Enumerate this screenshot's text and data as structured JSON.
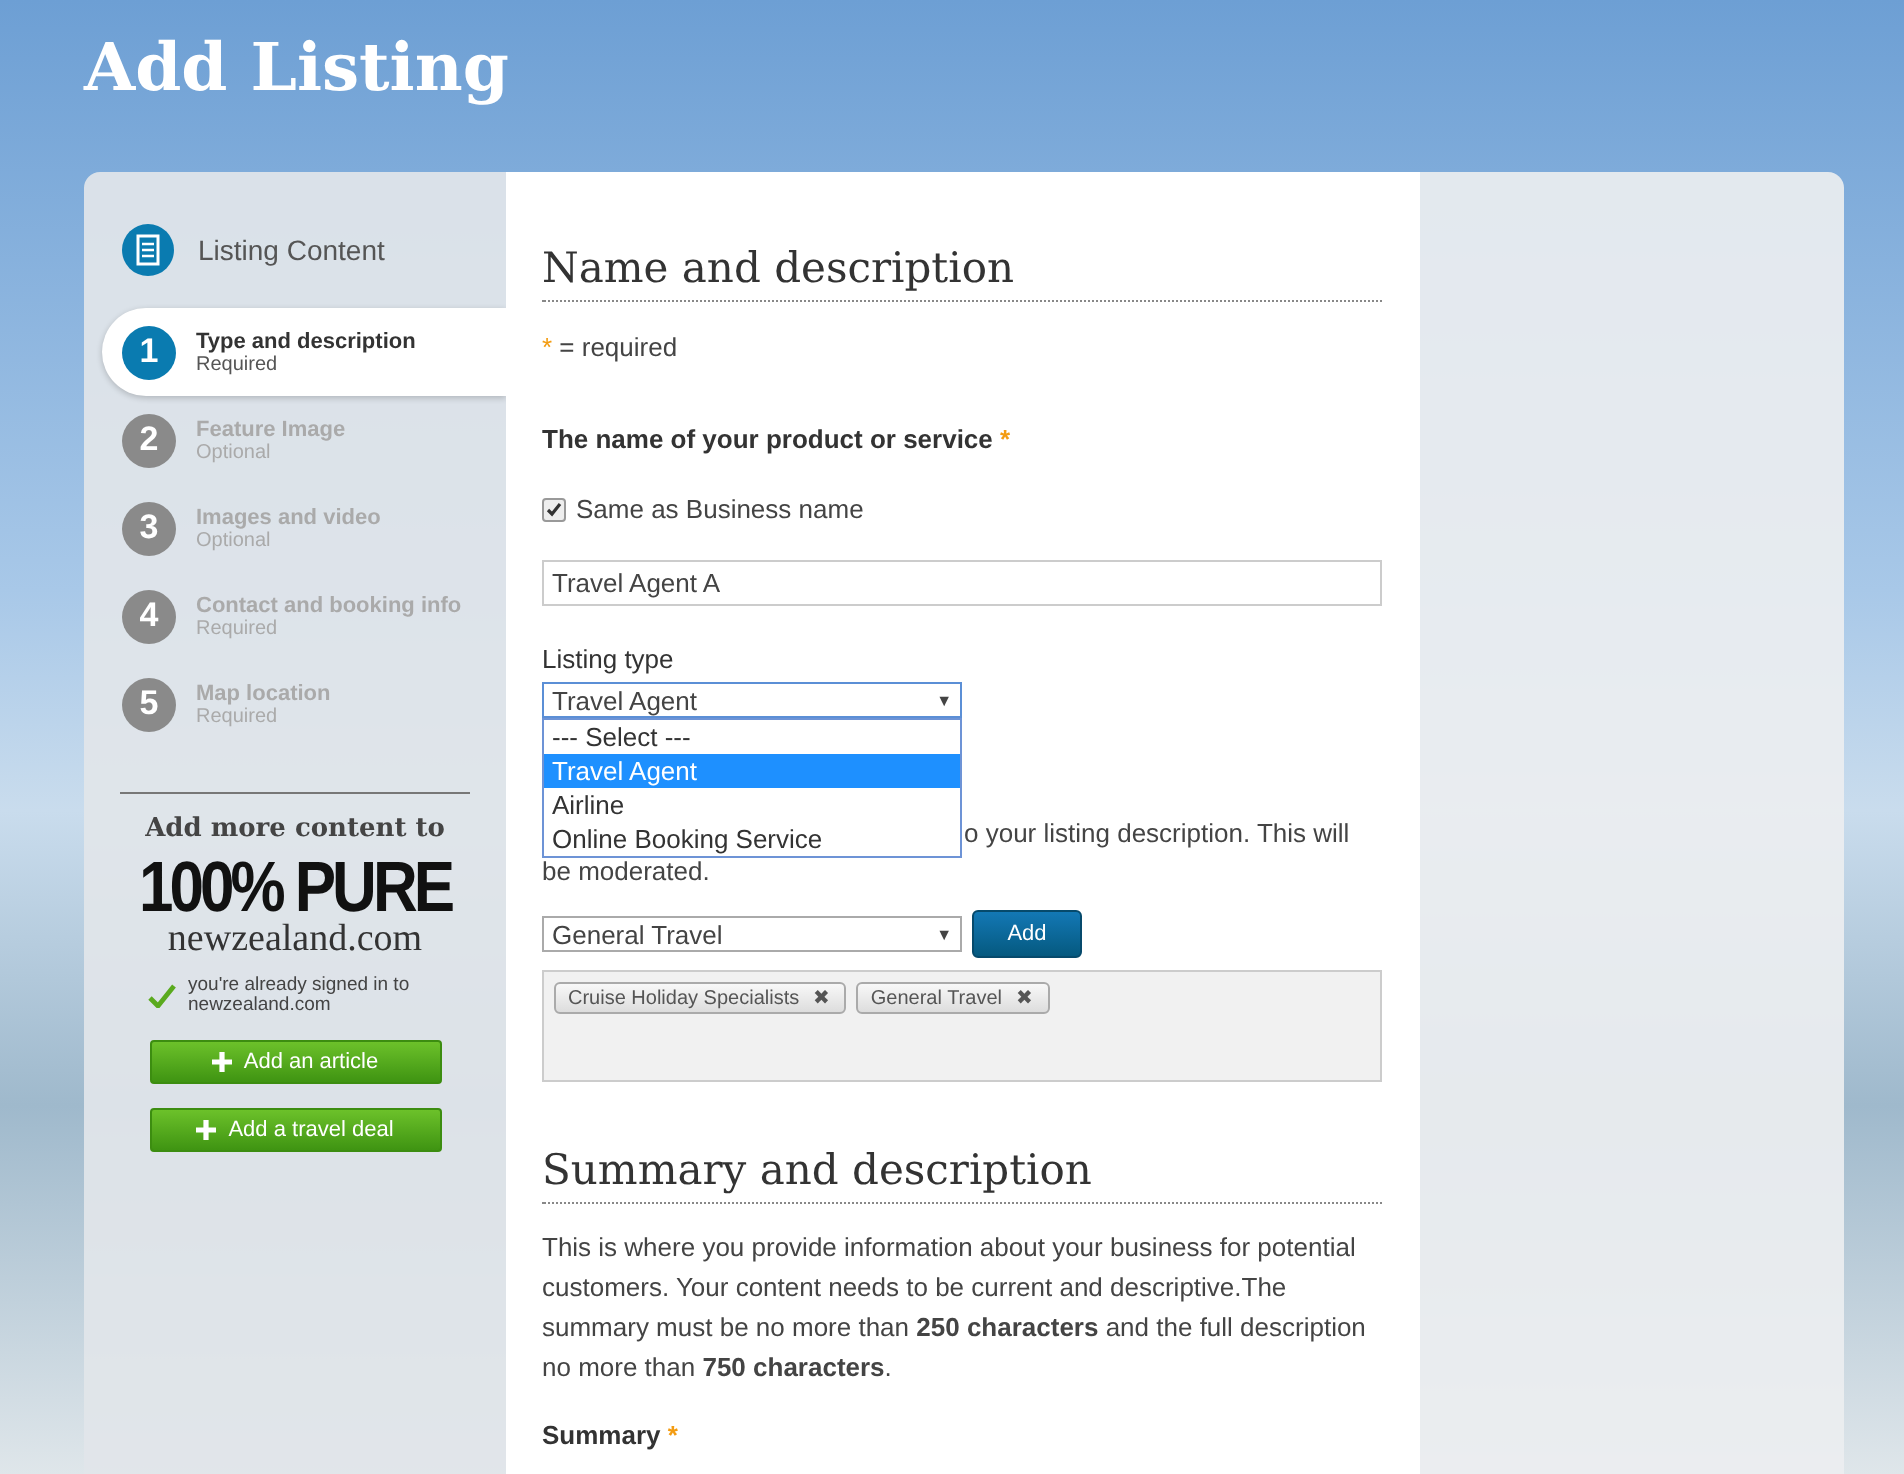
{
  "page_title": "Add Listing",
  "sidebar": {
    "header": "Listing Content",
    "steps": [
      {
        "number": "1",
        "title": "Type and description",
        "status": "Required",
        "selected": true
      },
      {
        "number": "2",
        "title": "Feature Image",
        "status": "Optional",
        "selected": false
      },
      {
        "number": "3",
        "title": "Images and video",
        "status": "Optional",
        "selected": false
      },
      {
        "number": "4",
        "title": "Contact and booking info",
        "status": "Required",
        "selected": false
      },
      {
        "number": "5",
        "title": "Map location",
        "status": "Required",
        "selected": false
      }
    ],
    "promo": {
      "heading": "Add more content to",
      "logo_line_1": "100% PURE",
      "logo_line_2": "newzealand.com",
      "signed_in_note": "you're already signed in to newzealand.com",
      "buttons": [
        "Add an article",
        "Add a travel deal"
      ]
    }
  },
  "form": {
    "section_1_title": "Name and description",
    "required_mark": "*",
    "required_note": "= required",
    "name_label": "The name of your product or service",
    "name_required": "*",
    "same_as_business": {
      "label": "Same as Business name",
      "checked": true
    },
    "name_value": "Travel Agent A",
    "listing_type": {
      "label": "Listing type",
      "value": "Travel Agent",
      "arrow": "▼",
      "options": [
        {
          "label": "--- Select ---",
          "selected": false
        },
        {
          "label": "Travel Agent",
          "selected": true
        },
        {
          "label": "Airline",
          "selected": false
        },
        {
          "label": "Online Booking Service",
          "selected": false
        }
      ]
    },
    "tags_note_lines": [
      "o your listing description. This will",
      "be moderated."
    ],
    "tag_select": {
      "value": "General Travel",
      "arrow": "▼"
    },
    "add_button": "Add",
    "tags": [
      {
        "label": "Cruise Holiday Specialists",
        "remove": "✖"
      },
      {
        "label": "General Travel",
        "remove": "✖"
      }
    ],
    "section_2_title": "Summary and description",
    "section_2_text": "This is where you provide information about your business for potential customers. Your content needs to be current and descriptive.The summary must be no more than **250 characters** and the full description no more than **750 characters**.",
    "summary_label": "Summary",
    "summary_required": "*"
  }
}
